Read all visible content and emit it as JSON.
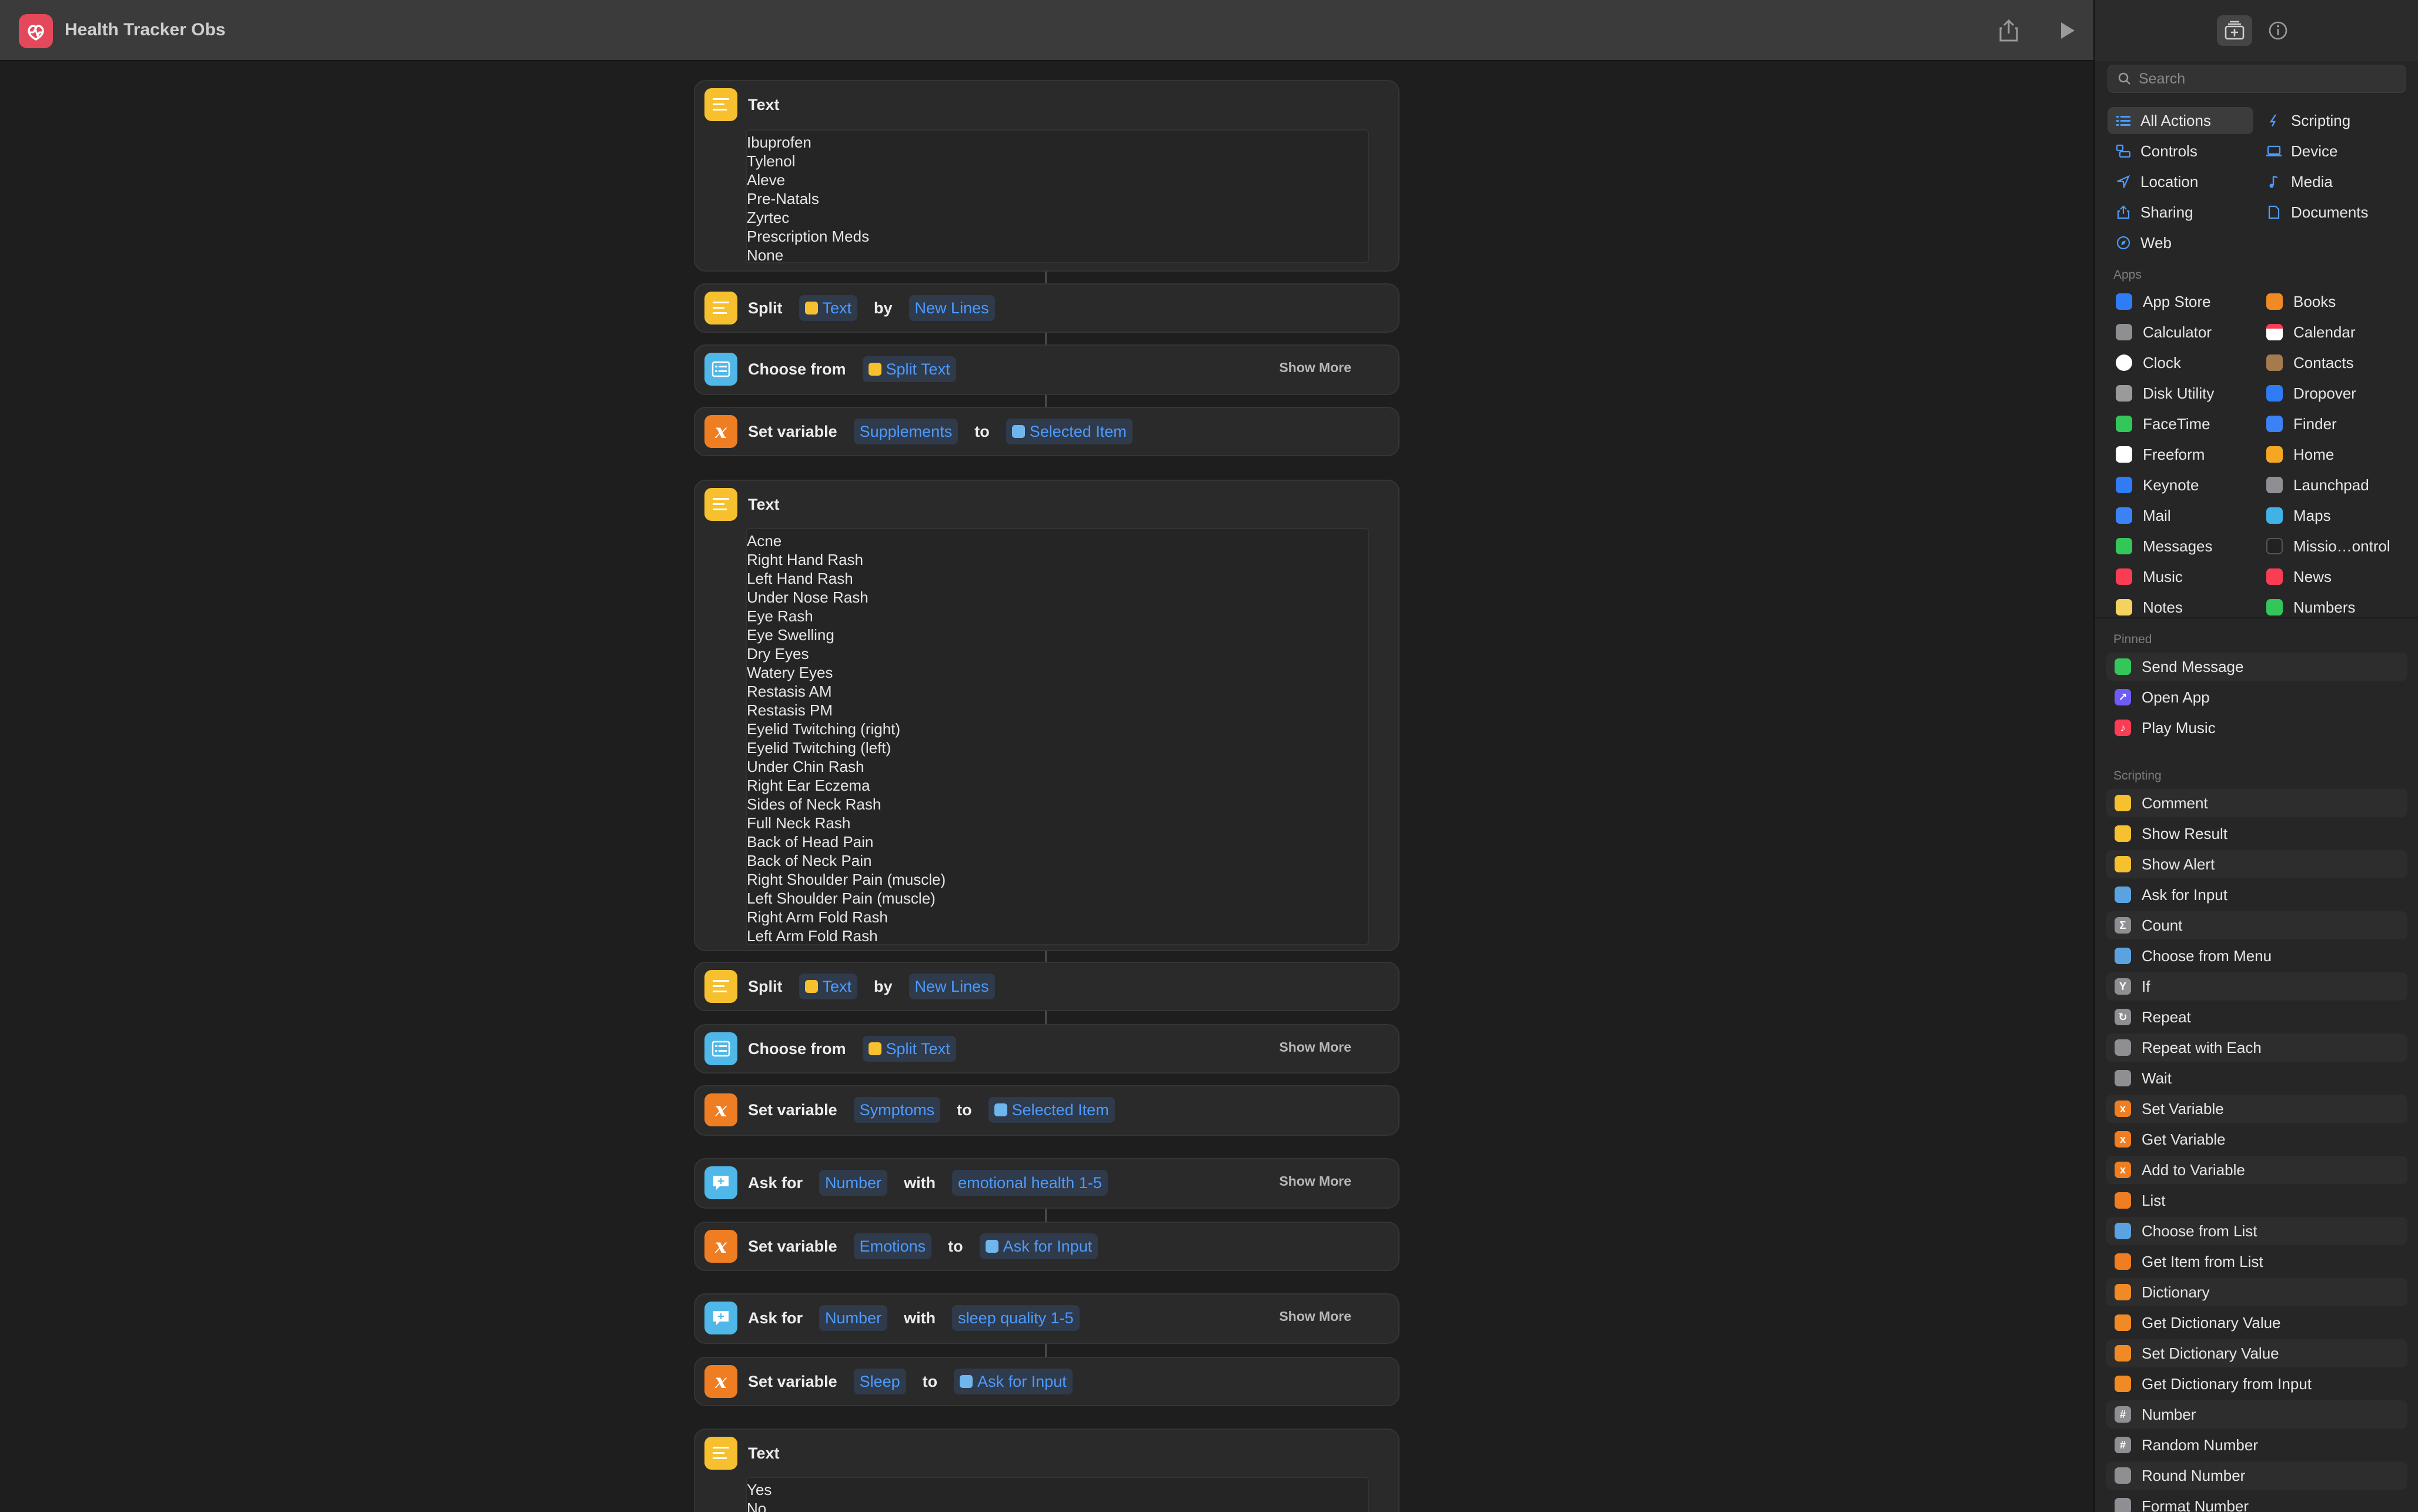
{
  "window": {
    "title": "Health Tracker Obs"
  },
  "editor": {
    "blocks": {
      "text1": {
        "label": "Text",
        "lines": [
          "Ibuprofen",
          "Tylenol",
          "Aleve",
          "Pre-Natals",
          "Zyrtec",
          "Prescription Meds",
          "None"
        ]
      },
      "split1": {
        "label": "Split",
        "token": "Text",
        "by": "by",
        "mode": "New Lines"
      },
      "choose1": {
        "label": "Choose from",
        "token": "Split Text",
        "more": "Show More"
      },
      "setvar1": {
        "label": "Set variable",
        "name": "Supplements",
        "to": "to",
        "value": "Selected Item"
      },
      "text2": {
        "label": "Text",
        "lines": [
          "Acne",
          "Right Hand Rash",
          "Left Hand Rash",
          "Under Nose Rash",
          "Eye Rash",
          "Eye Swelling",
          "Dry Eyes",
          "Watery Eyes",
          "Restasis AM",
          "Restasis PM",
          "Eyelid Twitching (right)",
          "Eyelid Twitching (left)",
          "Under Chin Rash",
          "Right Ear Eczema",
          "Sides of Neck Rash",
          "Full Neck Rash",
          "Back of Head Pain",
          "Back of Neck Pain",
          "Right Shoulder Pain (muscle)",
          "Left Shoulder Pain (muscle)",
          "Right Arm Fold Rash",
          "Left Arm Fold Rash"
        ]
      },
      "split2": {
        "label": "Split",
        "token": "Text",
        "by": "by",
        "mode": "New Lines"
      },
      "choose2": {
        "label": "Choose from",
        "token": "Split Text",
        "more": "Show More"
      },
      "setvar2": {
        "label": "Set variable",
        "name": "Symptoms",
        "to": "to",
        "value": "Selected Item"
      },
      "ask1": {
        "label": "Ask for",
        "type": "Number",
        "with": "with",
        "prompt": "emotional health 1-5",
        "more": "Show More"
      },
      "setvar3": {
        "label": "Set variable",
        "name": "Emotions",
        "to": "to",
        "value": "Ask for Input"
      },
      "ask2": {
        "label": "Ask for",
        "type": "Number",
        "with": "with",
        "prompt": "sleep quality 1-5",
        "more": "Show More"
      },
      "setvar4": {
        "label": "Set variable",
        "name": "Sleep",
        "to": "to",
        "value": "Ask for Input"
      },
      "text3": {
        "label": "Text",
        "lines": [
          "Yes",
          "No"
        ]
      }
    }
  },
  "sidebar": {
    "search_placeholder": "Search",
    "categories": [
      "All Actions",
      "Scripting",
      "Controls",
      "Device",
      "Location",
      "Media",
      "Sharing",
      "Documents",
      "Web"
    ],
    "apps_header": "Apps",
    "apps": [
      "App Store",
      "Books",
      "Calculator",
      "Calendar",
      "Clock",
      "Contacts",
      "Disk Utility",
      "Dropover",
      "FaceTime",
      "Finder",
      "Freeform",
      "Home",
      "Keynote",
      "Launchpad",
      "Mail",
      "Maps",
      "Messages",
      "Missio…ontrol",
      "Music",
      "News",
      "Notes",
      "Numbers"
    ],
    "app_colors": [
      "#2f7cf6",
      "#f08a24",
      "#8e8e93",
      "#ffffff",
      "#ffffff",
      "#a57a4c",
      "#9a9a9a",
      "#2f7cf6",
      "#33c759",
      "#3b82f6",
      "#ffffff",
      "#f5a623",
      "#2f7cf6",
      "#8e8e93",
      "#3b82f6",
      "#40b2e8",
      "#33c759",
      "#222222",
      "#fa3c55",
      "#fa3c55",
      "#f4d25e",
      "#33c759"
    ],
    "pinned_header": "Pinned",
    "pinned": [
      "Send Message",
      "Open App",
      "Play Music"
    ],
    "pinned_colors": [
      "#33c759",
      "#6f5cf6",
      "#fa3c55"
    ],
    "scripting_header": "Scripting",
    "scripting": [
      "Comment",
      "Show Result",
      "Show Alert",
      "Ask for Input",
      "Count",
      "Choose from Menu",
      "If",
      "Repeat",
      "Repeat with Each",
      "Wait",
      "Set Variable",
      "Get Variable",
      "Add to Variable",
      "List",
      "Choose from List",
      "Get Item from List",
      "Dictionary",
      "Get Dictionary Value",
      "Set Dictionary Value",
      "Get Dictionary from Input",
      "Number",
      "Random Number",
      "Round Number",
      "Format Number"
    ],
    "scripting_colors": [
      "#f6c02f",
      "#f6c02f",
      "#f6c02f",
      "#5aa3e0",
      "#8e8e93",
      "#5aa3e0",
      "#8e8e93",
      "#8e8e93",
      "#8e8e93",
      "#8e8e93",
      "#ef7d22",
      "#ef7d22",
      "#ef7d22",
      "#ef7d22",
      "#5aa3e0",
      "#ef7d22",
      "#f08a24",
      "#f08a24",
      "#f08a24",
      "#f08a24",
      "#8e8e93",
      "#8e8e93",
      "#8e8e93",
      "#8e8e93"
    ]
  }
}
